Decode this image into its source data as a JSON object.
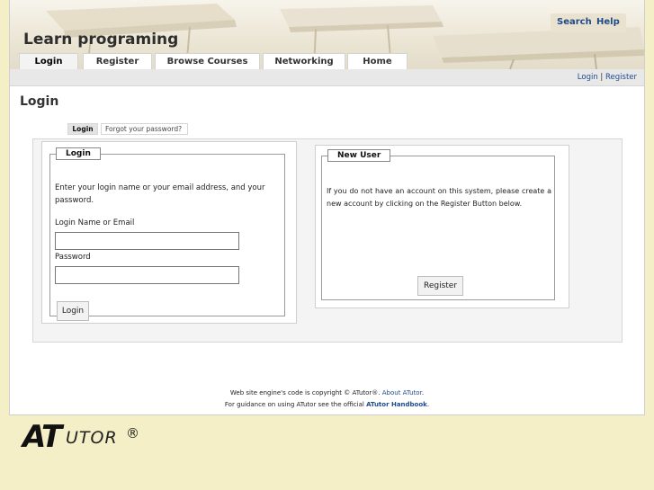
{
  "site": {
    "title": "Learn programing"
  },
  "top_links": {
    "search": "Search",
    "help": "Help"
  },
  "tabs": [
    {
      "label": "Login",
      "active": true
    },
    {
      "label": "Register"
    },
    {
      "label": "Browse Courses"
    },
    {
      "label": "Networking"
    },
    {
      "label": "Home"
    }
  ],
  "user_links": {
    "login": "Login",
    "separator": "|",
    "register": "Register"
  },
  "page": {
    "title": "Login"
  },
  "subtabs": {
    "login": "Login",
    "forgot": "Forgot your password?"
  },
  "login_panel": {
    "legend": "Login",
    "instructions": "Enter your login name or your email address, and your password.",
    "login_label": "Login Name or Email",
    "login_value": "",
    "password_label": "Password",
    "password_value": "",
    "button": "Login"
  },
  "new_user_panel": {
    "legend": "New User",
    "text": "If you do not have an account on this system, please create a new account by clicking on the Register Button below.",
    "button": "Register"
  },
  "footer": {
    "line1_text": "Web site engine's code is copyright © ATutor®.",
    "line1_link": "About ATutor",
    "line1_end": ".",
    "line2_text": "For guidance on using ATutor see the official",
    "line2_link": "ATutor Handbook",
    "line2_end": "."
  },
  "logo": {
    "a": "AT",
    "rest": "UTOR",
    "reg": "®"
  },
  "colors": {
    "page_background": "#f4efc6",
    "link": "#1f4a8a",
    "subbar": "#e8e8e8"
  }
}
